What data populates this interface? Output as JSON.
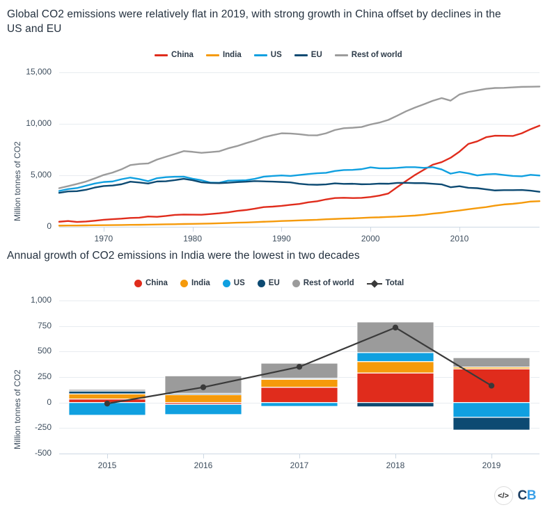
{
  "colors": {
    "china": "#e02c1c",
    "india": "#f59a0b",
    "us": "#10a0e0",
    "eu": "#0d4a72",
    "rest_of_world": "#9b9b9b",
    "total": "#3a3a3a",
    "grid": "#e8ecf0",
    "axis": "#cdd8e3",
    "text": "#3d4d5d",
    "logo_c": "#1d3f63",
    "logo_b": "#3aa0e8"
  },
  "chart1": {
    "title": "Global CO2 emissions were relatively flat in 2019, with strong growth in China offset by declines in the US and EU",
    "legend": [
      {
        "label": "China",
        "color": "#e02c1c",
        "marker": "line"
      },
      {
        "label": "India",
        "color": "#f59a0b",
        "marker": "line"
      },
      {
        "label": "US",
        "color": "#10a0e0",
        "marker": "line"
      },
      {
        "label": "EU",
        "color": "#0d4a72",
        "marker": "line"
      },
      {
        "label": "Rest of world",
        "color": "#9b9b9b",
        "marker": "line"
      }
    ]
  },
  "chart2": {
    "title": "Annual growth of CO2 emissions in India were the lowest in two decades",
    "legend": [
      {
        "label": "China",
        "color": "#e02c1c",
        "marker": "dot"
      },
      {
        "label": "India",
        "color": "#f59a0b",
        "marker": "dot"
      },
      {
        "label": "US",
        "color": "#10a0e0",
        "marker": "dot"
      },
      {
        "label": "EU",
        "color": "#0d4a72",
        "marker": "dot"
      },
      {
        "label": "Rest of world",
        "color": "#9b9b9b",
        "marker": "dot"
      },
      {
        "label": "Total",
        "color": "#3a3a3a",
        "marker": "line-diamond"
      }
    ]
  },
  "logo": {
    "code_glyph": "</>",
    "c": "C",
    "b": "B"
  },
  "chart_data": [
    {
      "type": "line",
      "title": "Global CO2 emissions were relatively flat in 2019, with strong growth in China offset by declines in the US and EU",
      "xlabel": "",
      "ylabel": "Million tonnes of CO2",
      "ylim": [
        0,
        15000
      ],
      "yticks": [
        0,
        5000,
        10000,
        15000
      ],
      "ytick_labels": [
        "0",
        "5,000",
        "10,000",
        "15,000"
      ],
      "xlim": [
        1965,
        2019
      ],
      "xticks": [
        1970,
        1980,
        1990,
        2000,
        2010
      ],
      "xtick_labels": [
        "1970",
        "1980",
        "1990",
        "2000",
        "2010"
      ],
      "grid": true,
      "legend_position": "top",
      "x": [
        1965,
        1966,
        1967,
        1968,
        1969,
        1970,
        1971,
        1972,
        1973,
        1974,
        1975,
        1976,
        1977,
        1978,
        1979,
        1980,
        1981,
        1982,
        1983,
        1984,
        1985,
        1986,
        1987,
        1988,
        1989,
        1990,
        1991,
        1992,
        1993,
        1994,
        1995,
        1996,
        1997,
        1998,
        1999,
        2000,
        2001,
        2002,
        2003,
        2004,
        2005,
        2006,
        2007,
        2008,
        2009,
        2010,
        2011,
        2012,
        2013,
        2014,
        2015,
        2016,
        2017,
        2018,
        2019
      ],
      "series": [
        {
          "name": "China",
          "color": "#e02c1c",
          "values": [
            490,
            560,
            470,
            510,
            590,
            680,
            740,
            790,
            860,
            880,
            1000,
            970,
            1050,
            1150,
            1190,
            1180,
            1170,
            1240,
            1310,
            1410,
            1540,
            1630,
            1760,
            1910,
            1960,
            2030,
            2130,
            2220,
            2380,
            2480,
            2660,
            2790,
            2820,
            2790,
            2810,
            2890,
            3030,
            3230,
            3850,
            4450,
            5030,
            5540,
            6030,
            6280,
            6700,
            7300,
            8050,
            8300,
            8700,
            8850,
            8840,
            8820,
            9080,
            9480,
            9820
          ]
        },
        {
          "name": "India",
          "color": "#f59a0b",
          "values": [
            110,
            120,
            125,
            135,
            145,
            155,
            165,
            175,
            190,
            195,
            205,
            225,
            240,
            250,
            270,
            280,
            300,
            320,
            340,
            365,
            400,
            420,
            455,
            490,
            520,
            560,
            590,
            620,
            650,
            680,
            730,
            760,
            800,
            820,
            860,
            900,
            920,
            960,
            990,
            1040,
            1090,
            1170,
            1280,
            1360,
            1480,
            1580,
            1700,
            1810,
            1910,
            2060,
            2170,
            2230,
            2330,
            2450,
            2490
          ]
        },
        {
          "name": "US",
          "color": "#10a0e0",
          "values": [
            3480,
            3660,
            3760,
            3980,
            4200,
            4350,
            4400,
            4620,
            4780,
            4630,
            4430,
            4720,
            4820,
            4860,
            4870,
            4670,
            4520,
            4290,
            4280,
            4480,
            4500,
            4520,
            4660,
            4870,
            4940,
            4990,
            4940,
            5030,
            5120,
            5200,
            5240,
            5420,
            5510,
            5530,
            5600,
            5770,
            5680,
            5680,
            5720,
            5790,
            5790,
            5720,
            5790,
            5570,
            5160,
            5330,
            5190,
            4990,
            5090,
            5130,
            5030,
            4940,
            4900,
            5050,
            4980
          ]
        },
        {
          "name": "EU",
          "color": "#0d4a72",
          "values": [
            3300,
            3430,
            3460,
            3590,
            3810,
            3960,
            4010,
            4130,
            4380,
            4300,
            4200,
            4400,
            4420,
            4530,
            4660,
            4520,
            4320,
            4250,
            4240,
            4280,
            4340,
            4380,
            4440,
            4410,
            4390,
            4350,
            4310,
            4180,
            4100,
            4080,
            4120,
            4220,
            4170,
            4180,
            4130,
            4140,
            4190,
            4180,
            4260,
            4270,
            4240,
            4240,
            4180,
            4120,
            3840,
            3940,
            3790,
            3750,
            3640,
            3530,
            3560,
            3560,
            3580,
            3510,
            3400
          ]
        },
        {
          "name": "Rest of world",
          "color": "#9b9b9b",
          "values": [
            3750,
            3950,
            4160,
            4390,
            4700,
            5030,
            5260,
            5580,
            5990,
            6100,
            6150,
            6530,
            6800,
            7070,
            7350,
            7280,
            7180,
            7250,
            7330,
            7620,
            7840,
            8120,
            8380,
            8690,
            8900,
            9080,
            9060,
            8990,
            8890,
            8880,
            9080,
            9400,
            9570,
            9620,
            9690,
            9940,
            10120,
            10380,
            10790,
            11220,
            11580,
            11900,
            12240,
            12500,
            12250,
            12850,
            13100,
            13250,
            13400,
            13480,
            13490,
            13540,
            13590,
            13600,
            13620
          ]
        }
      ]
    },
    {
      "type": "bar",
      "subtype": "stacked-with-line",
      "title": "Annual growth of CO2 emissions in India were the lowest in two decades",
      "xlabel": "",
      "ylabel": "Million tonnes of CO2",
      "ylim": [
        -500,
        1000
      ],
      "yticks": [
        -500,
        -250,
        0,
        250,
        500,
        750,
        1000
      ],
      "ytick_labels": [
        "-500",
        "-250",
        "0",
        "250",
        "500",
        "750",
        "1,000"
      ],
      "categories": [
        "2015",
        "2016",
        "2017",
        "2018",
        "2019"
      ],
      "grid": true,
      "legend_position": "top",
      "series": [
        {
          "name": "China",
          "color": "#e02c1c",
          "values": [
            35,
            -18,
            150,
            290,
            330
          ]
        },
        {
          "name": "India",
          "color": "#f59a0b",
          "values": [
            50,
            78,
            78,
            112,
            18
          ]
        },
        {
          "name": "US",
          "color": "#10a0e0",
          "values": [
            -125,
            -100,
            -38,
            88,
            -145
          ]
        },
        {
          "name": "EU",
          "color": "#0d4a72",
          "values": [
            28,
            12,
            10,
            -42,
            -125
          ]
        },
        {
          "name": "Rest of world",
          "color": "#9b9b9b",
          "values": [
            16,
            172,
            148,
            300,
            92
          ]
        }
      ],
      "total_line": {
        "name": "Total",
        "color": "#3a3a3a",
        "values": [
          -10,
          150,
          350,
          735,
          165
        ]
      }
    }
  ]
}
